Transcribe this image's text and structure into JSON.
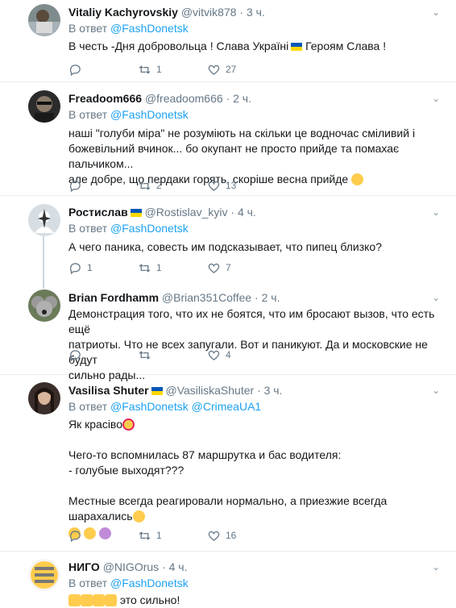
{
  "tweets": [
    {
      "name": "Vitaliy Kachyrovskiy",
      "handle": "@vitvik878",
      "time": "3 ч.",
      "reply_prefix": "В ответ",
      "reply_to": "@FashDonetsk",
      "text_a": "В честь -Дня добровольца ! Слава Україні",
      "text_b": "Героям Слава !",
      "replies": "",
      "retweets": "1",
      "likes": "27"
    },
    {
      "name": "Freadoom666",
      "handle": "@freadoom666",
      "time": "2 ч.",
      "reply_prefix": "В ответ",
      "reply_to": "@FashDonetsk",
      "text_lines": [
        "наші \"голуби міра\" не розуміють на скільки це водночас сміливий і",
        "божевільний вчинок... бо окупант не просто прийде та помахає пальчиком...",
        "але добре, що пердаки горять, скоріше весна прийде"
      ],
      "replies": "",
      "retweets": "2",
      "likes": "13"
    },
    {
      "name": "Ростислав",
      "handle": "@Rostislav_kyiv",
      "time": "4 ч.",
      "reply_prefix": "В ответ",
      "reply_to": "@FashDonetsk",
      "text": "А чего паника, совесть им  подсказывает, что пипец близко?",
      "replies": "1",
      "retweets": "1",
      "likes": "7"
    },
    {
      "name": "Brian Fordhamm",
      "handle": "@Brian351Coffee",
      "time": "2 ч.",
      "text_lines": [
        "Демонстрация того, что их не боятся, что им бросают вызов, что есть ещё",
        "патриоты. Что не всех запугали. Вот и паникуют. Да и московские не будут",
        "сильно рады..."
      ],
      "replies": "",
      "retweets": "",
      "likes": "4"
    },
    {
      "name": "Vasilisa Shuter",
      "handle": "@VasiliskaShuter",
      "time": "3 ч.",
      "reply_prefix": "В ответ",
      "reply_to": "@FashDonetsk",
      "reply_to_2": "@CrimeaUA1",
      "text_1": "Як красіво",
      "text_2": "Чего-то вспомнилась 87 маршрутка и бас водителя:",
      "text_3": "- голубые выходят???",
      "text_4": "Местные всегда реагировали нормально, а приезжие всегда шарахались",
      "replies": "",
      "retweets": "1",
      "likes": "16"
    },
    {
      "name": "НИГО",
      "handle": "@NIGOrus",
      "time": "4 ч.",
      "reply_prefix": "В ответ",
      "reply_to": "@FashDonetsk",
      "text": "это сильно!"
    }
  ],
  "colors": {
    "link": "#1da1f2",
    "muted": "#657786",
    "divider": "#e6ecf0",
    "flag_blue": "#0057b7",
    "flag_yellow": "#ffd700"
  }
}
